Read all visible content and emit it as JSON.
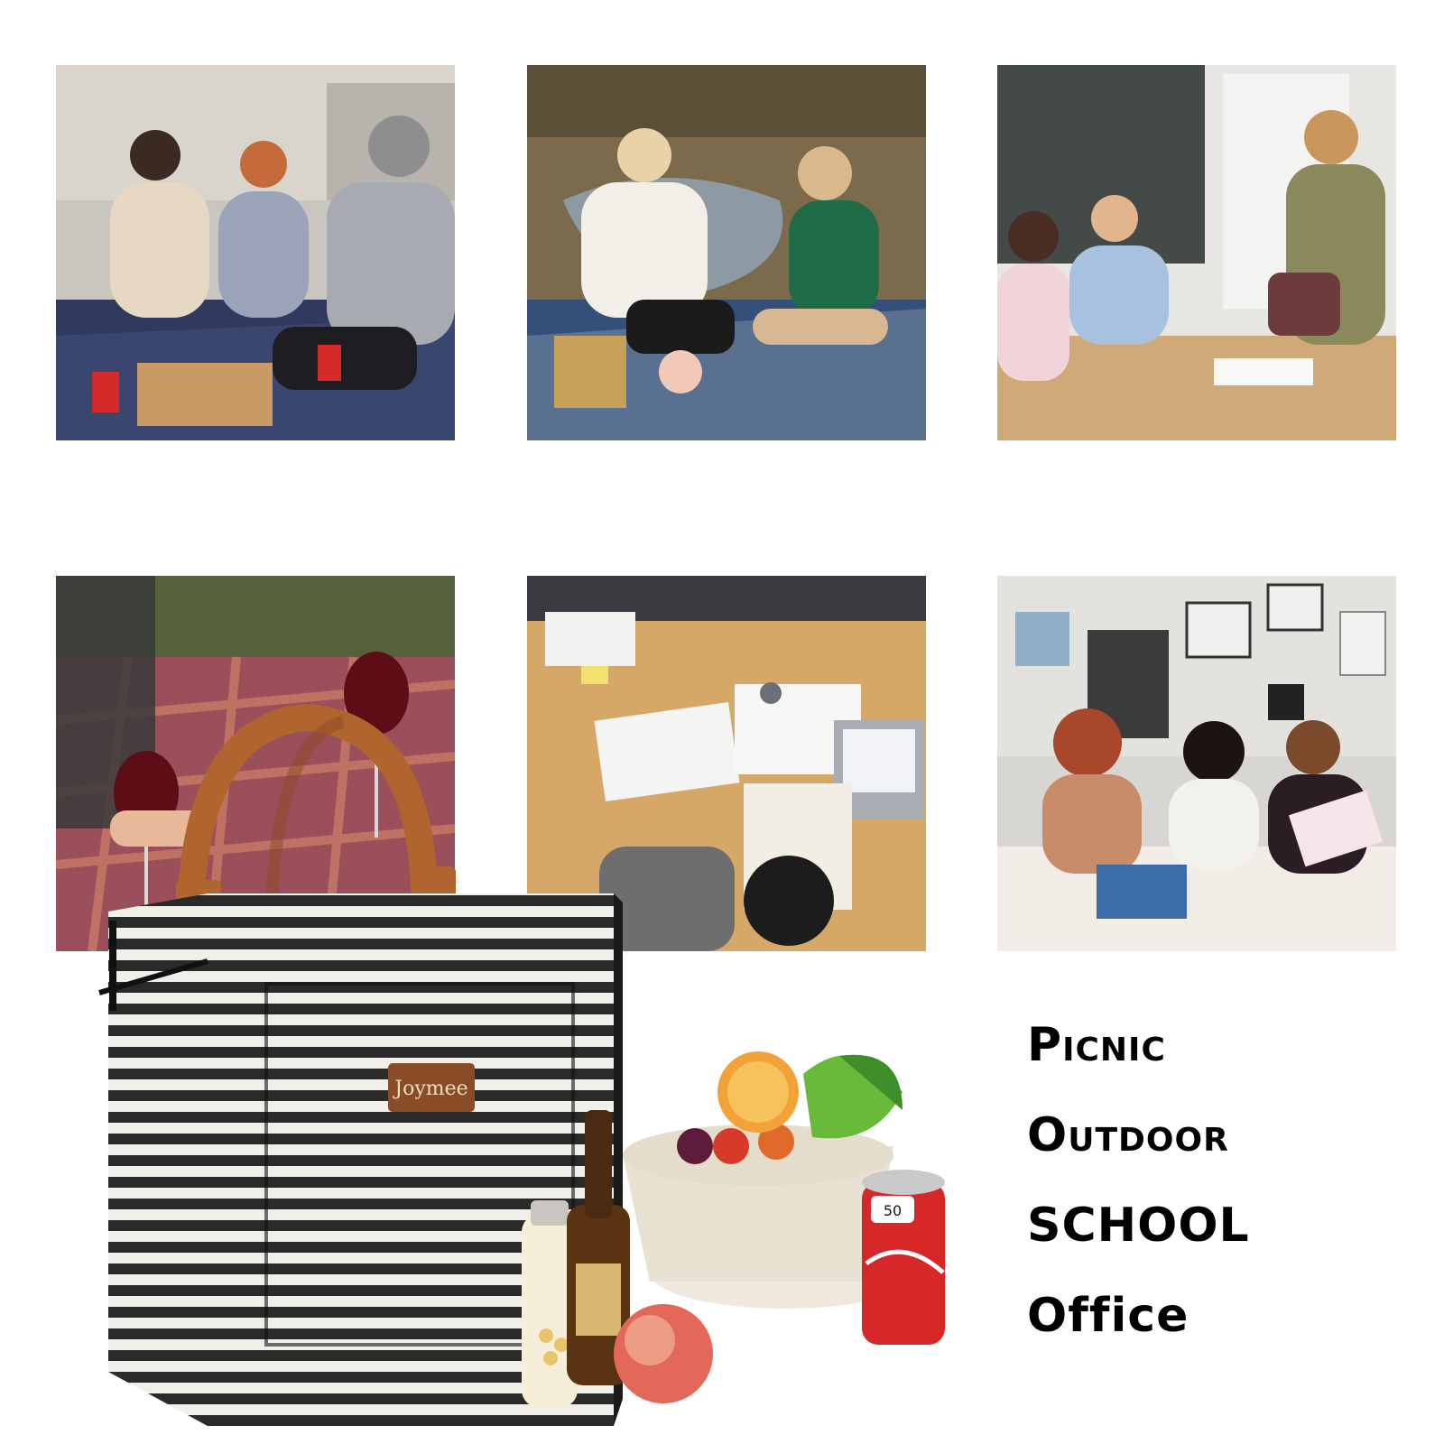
{
  "photos": [
    {
      "label": "photo-rooftop-pizza-picnic"
    },
    {
      "label": "photo-lakeside-picnic-drinks"
    },
    {
      "label": "photo-classroom-students"
    },
    {
      "label": "photo-wine-picnic-blanket"
    },
    {
      "label": "photo-office-meeting-table"
    },
    {
      "label": "photo-art-studio-class"
    }
  ],
  "product": {
    "brand_label": "Joymee",
    "can_label": "50"
  },
  "uses": [
    {
      "text": "Picnic",
      "style": "small-caps"
    },
    {
      "text": "Outdoor",
      "style": "small-caps"
    },
    {
      "text": "SCHOOL",
      "style": "caps"
    },
    {
      "text": "Office",
      "style": "normal"
    }
  ],
  "colors": {
    "background": "#ffffff",
    "text": "#000000",
    "handle": "#b0652f",
    "stripe_dark": "#2a2a2a",
    "stripe_light": "#f1efe9"
  }
}
